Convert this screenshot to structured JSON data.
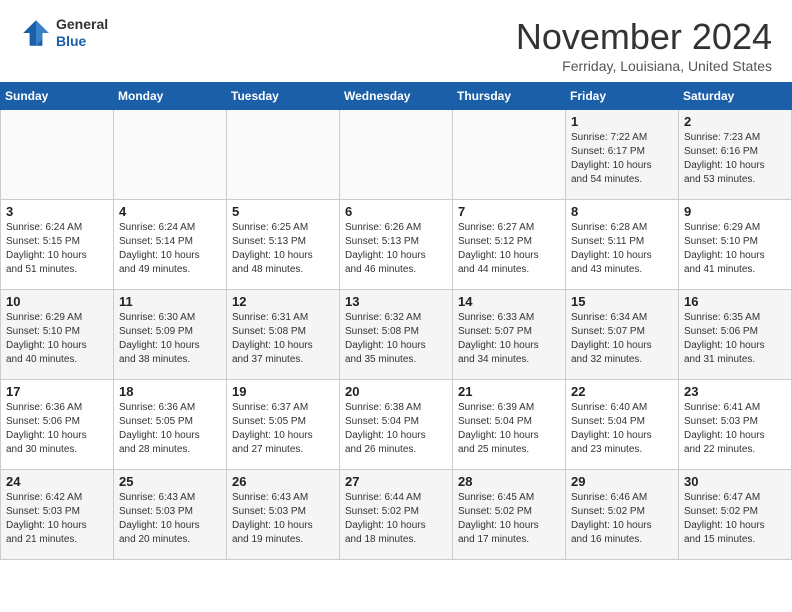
{
  "header": {
    "logo": {
      "line1": "General",
      "line2": "Blue"
    },
    "title": "November 2024",
    "location": "Ferriday, Louisiana, United States"
  },
  "days_of_week": [
    "Sunday",
    "Monday",
    "Tuesday",
    "Wednesday",
    "Thursday",
    "Friday",
    "Saturday"
  ],
  "weeks": [
    [
      {
        "day": "",
        "info": ""
      },
      {
        "day": "",
        "info": ""
      },
      {
        "day": "",
        "info": ""
      },
      {
        "day": "",
        "info": ""
      },
      {
        "day": "",
        "info": ""
      },
      {
        "day": "1",
        "info": "Sunrise: 7:22 AM\nSunset: 6:17 PM\nDaylight: 10 hours\nand 54 minutes."
      },
      {
        "day": "2",
        "info": "Sunrise: 7:23 AM\nSunset: 6:16 PM\nDaylight: 10 hours\nand 53 minutes."
      }
    ],
    [
      {
        "day": "3",
        "info": "Sunrise: 6:24 AM\nSunset: 5:15 PM\nDaylight: 10 hours\nand 51 minutes."
      },
      {
        "day": "4",
        "info": "Sunrise: 6:24 AM\nSunset: 5:14 PM\nDaylight: 10 hours\nand 49 minutes."
      },
      {
        "day": "5",
        "info": "Sunrise: 6:25 AM\nSunset: 5:13 PM\nDaylight: 10 hours\nand 48 minutes."
      },
      {
        "day": "6",
        "info": "Sunrise: 6:26 AM\nSunset: 5:13 PM\nDaylight: 10 hours\nand 46 minutes."
      },
      {
        "day": "7",
        "info": "Sunrise: 6:27 AM\nSunset: 5:12 PM\nDaylight: 10 hours\nand 44 minutes."
      },
      {
        "day": "8",
        "info": "Sunrise: 6:28 AM\nSunset: 5:11 PM\nDaylight: 10 hours\nand 43 minutes."
      },
      {
        "day": "9",
        "info": "Sunrise: 6:29 AM\nSunset: 5:10 PM\nDaylight: 10 hours\nand 41 minutes."
      }
    ],
    [
      {
        "day": "10",
        "info": "Sunrise: 6:29 AM\nSunset: 5:10 PM\nDaylight: 10 hours\nand 40 minutes."
      },
      {
        "day": "11",
        "info": "Sunrise: 6:30 AM\nSunset: 5:09 PM\nDaylight: 10 hours\nand 38 minutes."
      },
      {
        "day": "12",
        "info": "Sunrise: 6:31 AM\nSunset: 5:08 PM\nDaylight: 10 hours\nand 37 minutes."
      },
      {
        "day": "13",
        "info": "Sunrise: 6:32 AM\nSunset: 5:08 PM\nDaylight: 10 hours\nand 35 minutes."
      },
      {
        "day": "14",
        "info": "Sunrise: 6:33 AM\nSunset: 5:07 PM\nDaylight: 10 hours\nand 34 minutes."
      },
      {
        "day": "15",
        "info": "Sunrise: 6:34 AM\nSunset: 5:07 PM\nDaylight: 10 hours\nand 32 minutes."
      },
      {
        "day": "16",
        "info": "Sunrise: 6:35 AM\nSunset: 5:06 PM\nDaylight: 10 hours\nand 31 minutes."
      }
    ],
    [
      {
        "day": "17",
        "info": "Sunrise: 6:36 AM\nSunset: 5:06 PM\nDaylight: 10 hours\nand 30 minutes."
      },
      {
        "day": "18",
        "info": "Sunrise: 6:36 AM\nSunset: 5:05 PM\nDaylight: 10 hours\nand 28 minutes."
      },
      {
        "day": "19",
        "info": "Sunrise: 6:37 AM\nSunset: 5:05 PM\nDaylight: 10 hours\nand 27 minutes."
      },
      {
        "day": "20",
        "info": "Sunrise: 6:38 AM\nSunset: 5:04 PM\nDaylight: 10 hours\nand 26 minutes."
      },
      {
        "day": "21",
        "info": "Sunrise: 6:39 AM\nSunset: 5:04 PM\nDaylight: 10 hours\nand 25 minutes."
      },
      {
        "day": "22",
        "info": "Sunrise: 6:40 AM\nSunset: 5:04 PM\nDaylight: 10 hours\nand 23 minutes."
      },
      {
        "day": "23",
        "info": "Sunrise: 6:41 AM\nSunset: 5:03 PM\nDaylight: 10 hours\nand 22 minutes."
      }
    ],
    [
      {
        "day": "24",
        "info": "Sunrise: 6:42 AM\nSunset: 5:03 PM\nDaylight: 10 hours\nand 21 minutes."
      },
      {
        "day": "25",
        "info": "Sunrise: 6:43 AM\nSunset: 5:03 PM\nDaylight: 10 hours\nand 20 minutes."
      },
      {
        "day": "26",
        "info": "Sunrise: 6:43 AM\nSunset: 5:03 PM\nDaylight: 10 hours\nand 19 minutes."
      },
      {
        "day": "27",
        "info": "Sunrise: 6:44 AM\nSunset: 5:02 PM\nDaylight: 10 hours\nand 18 minutes."
      },
      {
        "day": "28",
        "info": "Sunrise: 6:45 AM\nSunset: 5:02 PM\nDaylight: 10 hours\nand 17 minutes."
      },
      {
        "day": "29",
        "info": "Sunrise: 6:46 AM\nSunset: 5:02 PM\nDaylight: 10 hours\nand 16 minutes."
      },
      {
        "day": "30",
        "info": "Sunrise: 6:47 AM\nSunset: 5:02 PM\nDaylight: 10 hours\nand 15 minutes."
      }
    ]
  ]
}
